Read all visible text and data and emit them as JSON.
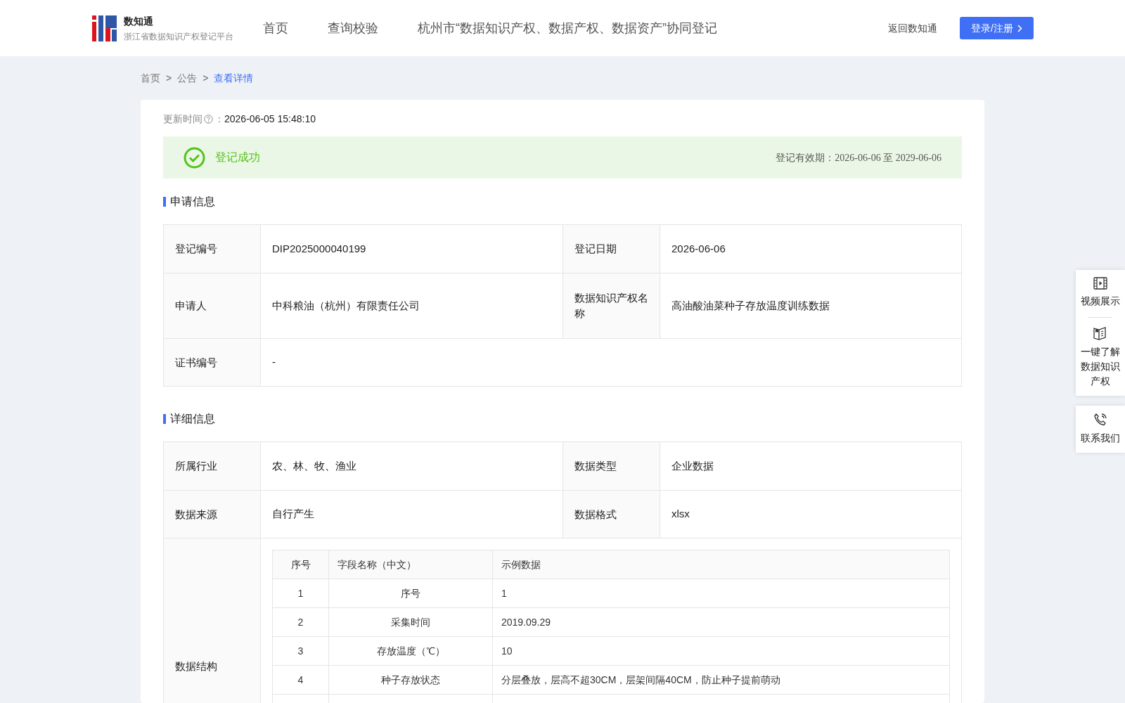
{
  "header": {
    "logo_title": "数知通",
    "logo_subtitle": "浙江省数据知识产权登记平台",
    "nav": [
      {
        "label": "首页",
        "selected": false
      },
      {
        "label": "查询校验",
        "selected": false
      },
      {
        "label": "杭州市“数据知识产权、数据产权、数据资产”协同登记",
        "selected": false
      }
    ],
    "back_link": "返回数知通",
    "login_button": "登录/注册"
  },
  "breadcrumb": [
    {
      "label": "首页",
      "selected": false
    },
    {
      "label": "公告",
      "selected": false
    },
    {
      "label": "查看详情",
      "selected": true
    }
  ],
  "breadcrumb_separator": ">",
  "update_time": {
    "label": "更新时间",
    "colon": "：",
    "value": "2026-06-05 15:48:10"
  },
  "status": {
    "text": "登记成功",
    "validity": "登记有效期：2026-06-06 至 2029-06-06"
  },
  "sections": [
    {
      "title": "申请信息",
      "rows": [
        {
          "cells": [
            {
              "label": "登记编号",
              "value": "DIP2025000040199"
            },
            {
              "label": "登记日期",
              "value": "2026-06-06"
            }
          ]
        },
        {
          "cells": [
            {
              "label": "申请人",
              "value": "中科粮油（杭州）有限责任公司"
            },
            {
              "label": "数据知识产权名称",
              "value": "高油酸油菜种子存放温度训练数据"
            }
          ]
        },
        {
          "cells": [
            {
              "label": "证书编号",
              "value": "-"
            }
          ]
        }
      ]
    },
    {
      "title": "详细信息",
      "rows": [
        {
          "cells": [
            {
              "label": "所属行业",
              "value": "农、林、牧、渔业"
            },
            {
              "label": "数据类型",
              "value": "企业数据"
            }
          ]
        },
        {
          "cells": [
            {
              "label": "数据来源",
              "value": "自行产生"
            },
            {
              "label": "数据格式",
              "value": "xlsx"
            }
          ]
        }
      ],
      "structure": {
        "label": "数据结构",
        "columns": [
          "序号",
          "字段名称（中文）",
          "示例数据"
        ],
        "rows": [
          [
            "1",
            "序号",
            "1"
          ],
          [
            "2",
            "采集时间",
            "2019.09.29"
          ],
          [
            "3",
            "存放温度（℃）",
            "10"
          ],
          [
            "4",
            "种子存放状态",
            "分层叠放，层高不超30CM，层架间隔40CM，防止种子提前萌动"
          ]
        ]
      }
    }
  ],
  "side_panel": [
    {
      "kind": "video",
      "label": "视频展示"
    },
    {
      "kind": "book",
      "label": "一键了解数据知识产权"
    },
    {
      "kind": "phone",
      "label": "联系我们"
    }
  ]
}
